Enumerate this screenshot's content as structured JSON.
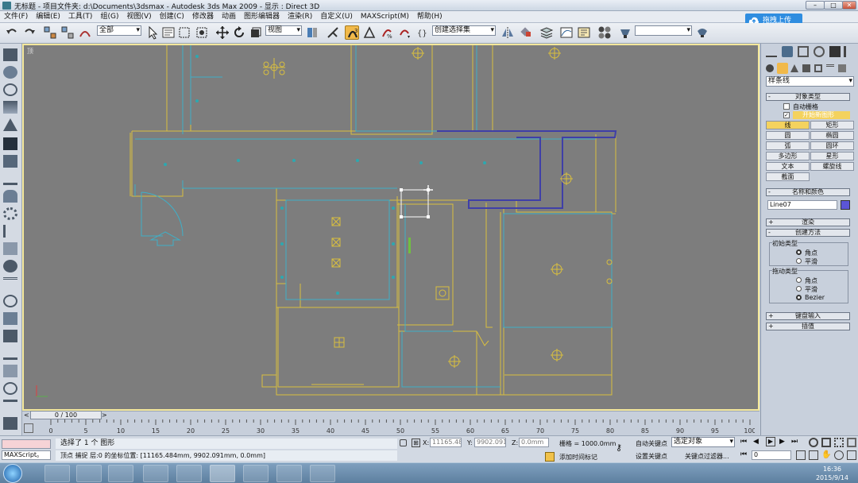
{
  "titlebar": {
    "text": "无标题 - 项目文件夹: d:\\Documents\\3dsmax - Autodesk 3ds Max 2009 - 显示 : Direct 3D",
    "min": "–",
    "max": "□",
    "close": "✕"
  },
  "menu": [
    "文件(F)",
    "编辑(E)",
    "工具(T)",
    "组(G)",
    "视图(V)",
    "创建(C)",
    "修改器",
    "动画",
    "图形编辑器",
    "渲染(R)",
    "自定义(U)",
    "MAXScript(M)",
    "帮助(H)"
  ],
  "upload": "拖拽上传",
  "toolbar": {
    "filter": "全部",
    "coord": "视图",
    "named_sel": "创建选择集",
    "blank": ""
  },
  "viewport": {
    "label": "顶"
  },
  "cmd": {
    "category": "样条线",
    "rollouts": {
      "object_type": "对象类型",
      "name_color": "名称和颜色",
      "render": "渲染",
      "create_method": "创建方法",
      "keyboard": "键盘输入",
      "interp": "插值"
    },
    "autogrid": "自动栅格",
    "start_new": "开始新图形",
    "buttons": [
      "线",
      "矩形",
      "圆",
      "椭圆",
      "弧",
      "圆环",
      "多边形",
      "星形",
      "文本",
      "螺旋线",
      "截面"
    ],
    "object_name": "Line07",
    "initial_type": "初始类型",
    "drag_type": "拖动类型",
    "corner": "角点",
    "smooth": "平滑",
    "bezier": "Bezier"
  },
  "timeline": {
    "frame": "0 / 100",
    "ticks": [
      "0",
      "5",
      "10",
      "15",
      "20",
      "25",
      "30",
      "35",
      "40",
      "45",
      "50",
      "55",
      "60",
      "65",
      "70",
      "75",
      "80",
      "85",
      "90",
      "95",
      "100"
    ]
  },
  "status": {
    "maxscript": "MAXScript。",
    "sel": "选择了 1 个 图形",
    "prompt": "顶点 捕捉 层:0 的坐标位置: [11165.484mm, 9902.091mm, 0.0mm]",
    "x_label": "X:",
    "x": "11165.484",
    "y_label": "Y:",
    "y": "9902.091m",
    "z_label": "Z:",
    "z": "0.0mm",
    "grid": "栅格 = 1000.0mm",
    "autokey": "自动关键点",
    "setkey": "设置关键点",
    "selobj": "选定对象",
    "keyfilter": "关键点过滤器...",
    "addtime": "添加时间标记",
    "frame": "0"
  },
  "clock": {
    "time": "16:36",
    "date": "2015/9/14"
  }
}
